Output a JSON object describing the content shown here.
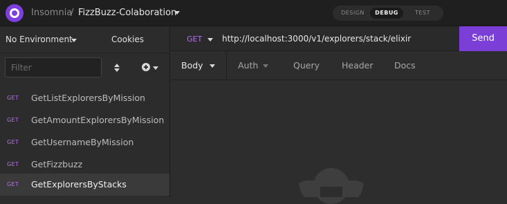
{
  "app": {
    "name": "Insomnia",
    "separator": "/",
    "project": "FizzBuzz-Colaboration"
  },
  "modes": [
    {
      "label": "DESIGN",
      "active": false
    },
    {
      "label": "DEBUG",
      "active": true
    },
    {
      "label": "TEST",
      "active": false
    }
  ],
  "sidebar": {
    "environment": "No Environment",
    "cookies": "Cookies",
    "filter_placeholder": "Filter",
    "requests": [
      {
        "method": "GET",
        "name": "GetListExplorersByMission",
        "active": false
      },
      {
        "method": "GET",
        "name": "GetAmountExplorersByMission",
        "active": false
      },
      {
        "method": "GET",
        "name": "GetUsernameByMission",
        "active": false
      },
      {
        "method": "GET",
        "name": "GetFizzbuzz",
        "active": false
      },
      {
        "method": "GET",
        "name": "GetExplorersByStacks",
        "active": true
      }
    ]
  },
  "request": {
    "method": "GET",
    "url": "http://localhost:3000/v1/explorers/stack/elixir",
    "send_label": "Send"
  },
  "tabs": [
    {
      "label": "Body",
      "active": true
    },
    {
      "label": "Auth",
      "active": false
    },
    {
      "label": "Query",
      "active": false
    },
    {
      "label": "Header",
      "active": false
    },
    {
      "label": "Docs",
      "active": false
    }
  ],
  "colors": {
    "accent": "#7e3fe0",
    "method": "#b76ef2",
    "background": "#2d2d2d"
  }
}
